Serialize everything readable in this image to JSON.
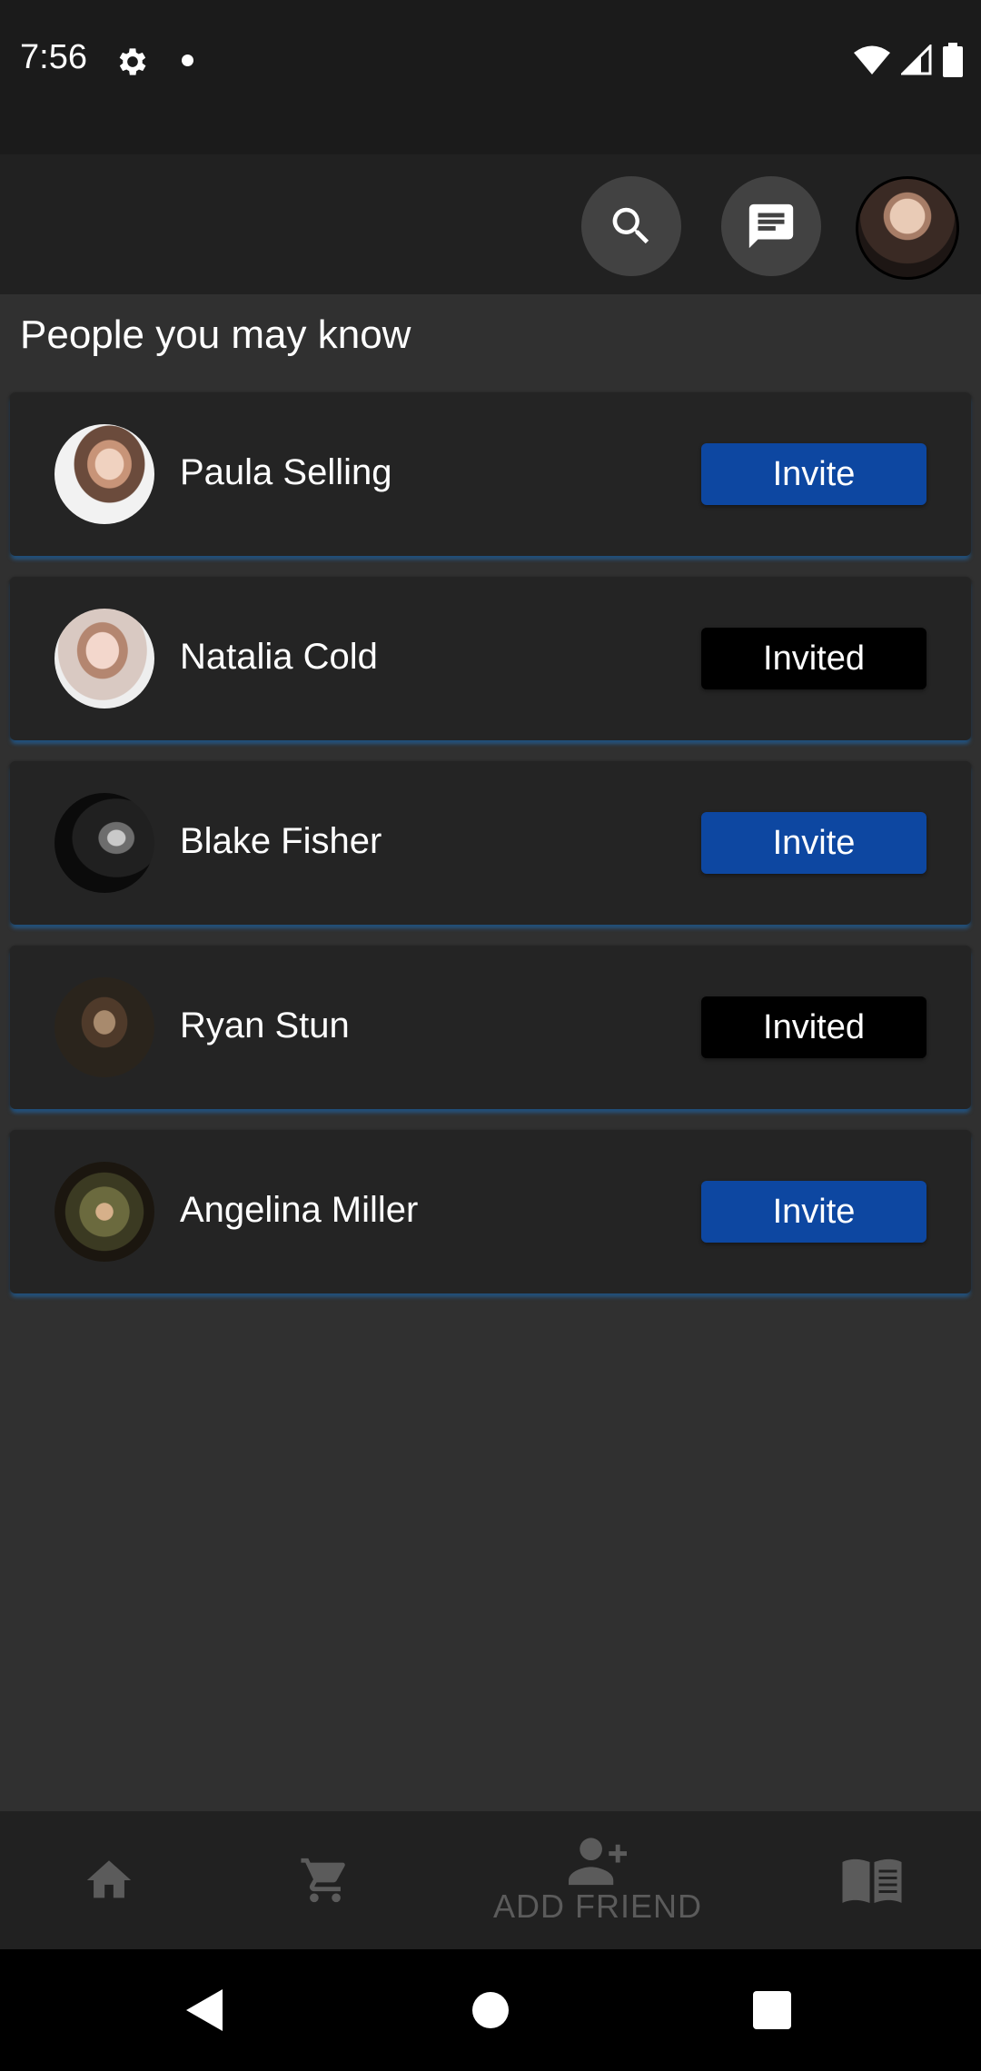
{
  "status_bar": {
    "time": "7:56",
    "icons": [
      "gear-icon",
      "notification-dot-icon",
      "wifi-icon",
      "cell-signal-icon",
      "battery-icon"
    ]
  },
  "app_bar": {
    "search_icon": "search-icon",
    "messages_icon": "chat-icon",
    "profile_icon": "avatar"
  },
  "section": {
    "title": "People you may know"
  },
  "people": [
    {
      "name": "Paula Selling",
      "action": "Invite",
      "state": "invite"
    },
    {
      "name": "Natalia Cold",
      "action": "Invited",
      "state": "invited"
    },
    {
      "name": "Blake Fisher",
      "action": "Invite",
      "state": "invite"
    },
    {
      "name": "Ryan Stun",
      "action": "Invited",
      "state": "invited"
    },
    {
      "name": "Angelina Miller",
      "action": "Invite",
      "state": "invite"
    }
  ],
  "bottom_nav": {
    "items": [
      {
        "icon": "home-icon",
        "label": ""
      },
      {
        "icon": "cart-icon",
        "label": ""
      },
      {
        "icon": "add-friend-icon",
        "label": "ADD FRIEND"
      },
      {
        "icon": "book-icon",
        "label": ""
      }
    ]
  },
  "colors": {
    "background": "#303030",
    "bar": "#212121",
    "card": "#242424",
    "invite_button": "#0d47a1",
    "invited_button": "#000000",
    "card_glow": "#2178c8"
  }
}
